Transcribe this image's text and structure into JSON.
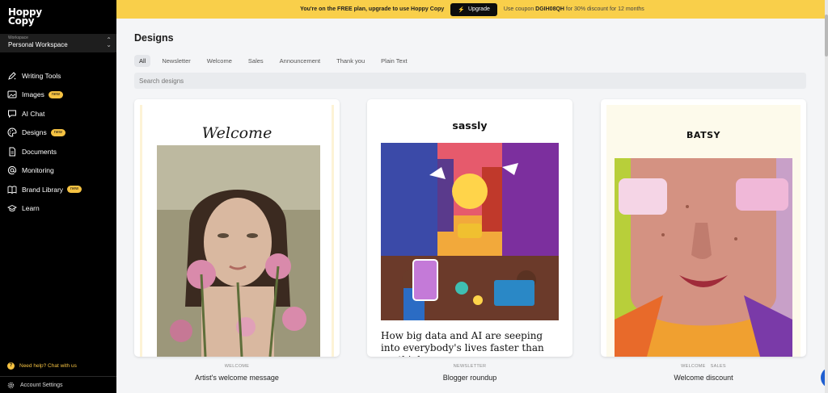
{
  "sidebar": {
    "logo_line1": "Hoppy",
    "logo_line2": "Copy",
    "workspace_caption": "Workspace",
    "workspace_name": "Personal Workspace",
    "items": [
      {
        "label": "Writing Tools",
        "icon": "pen-icon",
        "badge": ""
      },
      {
        "label": "Images",
        "icon": "image-icon",
        "badge": "new"
      },
      {
        "label": "AI Chat",
        "icon": "chat-icon",
        "badge": ""
      },
      {
        "label": "Designs",
        "icon": "palette-icon",
        "badge": "new"
      },
      {
        "label": "Documents",
        "icon": "document-icon",
        "badge": ""
      },
      {
        "label": "Monitoring",
        "icon": "at-icon",
        "badge": ""
      },
      {
        "label": "Brand Library",
        "icon": "book-icon",
        "badge": "new"
      },
      {
        "label": "Learn",
        "icon": "graduation-icon",
        "badge": ""
      }
    ],
    "help_text": "Need help? Chat with us",
    "account_settings": "Account Settings"
  },
  "banner": {
    "text_before": "You're on the FREE plan, upgrade to use Hoppy Copy",
    "upgrade_label": "Upgrade",
    "coupon_prefix": "Use coupon",
    "coupon_code": "DGIH08QH",
    "coupon_suffix": "for 30% discount for 12 months"
  },
  "main": {
    "title": "Designs",
    "filters": [
      "All",
      "Newsletter",
      "Welcome",
      "Sales",
      "Announcement",
      "Thank you",
      "Plain Text"
    ],
    "active_filter": "All",
    "search_placeholder": "Search designs"
  },
  "cards": [
    {
      "heading": "Welcome",
      "tags": [
        "WELCOME"
      ],
      "name": "Artist's welcome message"
    },
    {
      "heading": "sassly",
      "body": "How big data and AI are seeping into everybody's lives faster than we think",
      "tags": [
        "NEWSLETTER"
      ],
      "name": "Blogger roundup"
    },
    {
      "heading": "BATSY",
      "tags": [
        "WELCOME",
        "SALES"
      ],
      "name": "Welcome discount"
    }
  ],
  "colors": {
    "accent": "#f9cf4a",
    "sidebar_bg": "#000000",
    "chat_button": "#1f5fd1"
  }
}
